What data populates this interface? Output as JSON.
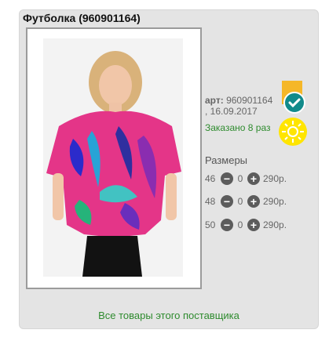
{
  "product": {
    "title": "Футболка (960901164)",
    "art_label": "арт:",
    "art_value": "960901164",
    "date": ", 16.09.2017",
    "ordered_text": "Заказано 8 раз"
  },
  "sizes": {
    "title": "Размеры",
    "rows": [
      {
        "size": "46",
        "qty": "0",
        "price": "290р."
      },
      {
        "size": "48",
        "qty": "0",
        "price": "290р."
      },
      {
        "size": "50",
        "qty": "0",
        "price": "290р."
      }
    ]
  },
  "footer": {
    "supplier_link": "Все товары этого поставщика"
  },
  "colors": {
    "ordered": "#2e8b2e",
    "badge": "#f5b728",
    "check": "#128b8b",
    "sun": "#ffe500"
  }
}
